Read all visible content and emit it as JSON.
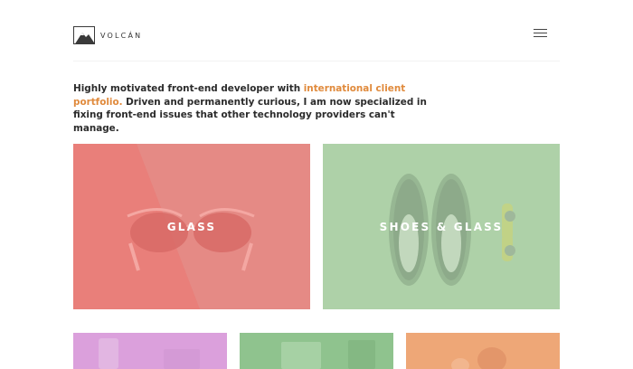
{
  "header": {
    "brand": "VOLCÁN",
    "logo_icon": "mountain-icon",
    "menu_icon": "hamburger-menu-icon"
  },
  "intro": {
    "text_before": "Highly motivated front-end developer with ",
    "accent_text": "international client portfolio.",
    "text_after": " Driven and permanently curious, I am now specialized in fixing front-end issues that other technology providers can't manage."
  },
  "portfolio": {
    "tiles": [
      {
        "label": "GLASS",
        "color": "#e8817c"
      },
      {
        "label": "SHOES & GLASS",
        "color": "#aed1a8"
      },
      {
        "label": "",
        "color": "#dba0dc"
      },
      {
        "label": "",
        "color": "#8fc38e"
      },
      {
        "label": "",
        "color": "#eea777"
      }
    ]
  },
  "colors": {
    "accent": "#e08a3c",
    "text": "#2b2b2b"
  }
}
